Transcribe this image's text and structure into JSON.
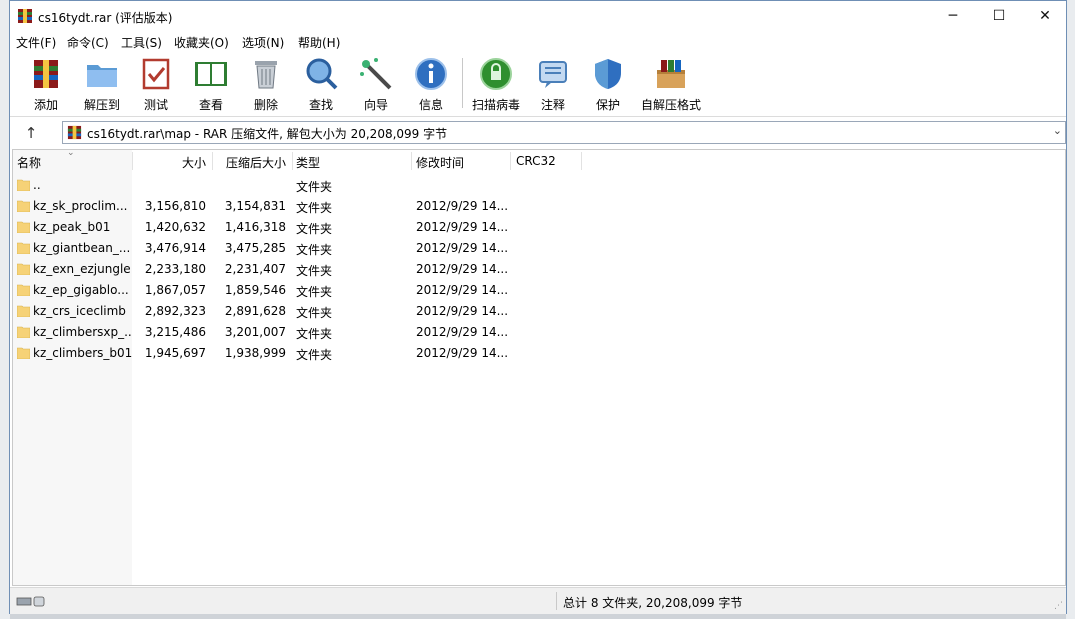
{
  "window": {
    "title": "cs16tydt.rar (评估版本)",
    "minimize": "─",
    "maximize": "☐",
    "close": "✕"
  },
  "menu": [
    "文件(F)",
    "命令(C)",
    "工具(S)",
    "收藏夹(O)",
    "选项(N)",
    "帮助(H)"
  ],
  "toolbar": [
    {
      "label": "添加",
      "icon": "add-archive-icon"
    },
    {
      "label": "解压到",
      "icon": "extract-folder-icon"
    },
    {
      "label": "测试",
      "icon": "test-checklist-icon"
    },
    {
      "label": "查看",
      "icon": "view-book-icon"
    },
    {
      "label": "删除",
      "icon": "trash-icon"
    },
    {
      "label": "查找",
      "icon": "magnifier-icon"
    },
    {
      "label": "向导",
      "icon": "wizard-wand-icon"
    },
    {
      "label": "信息",
      "icon": "info-icon"
    },
    {
      "label": "扫描病毒",
      "icon": "virus-scan-icon"
    },
    {
      "label": "注释",
      "icon": "comment-icon"
    },
    {
      "label": "保护",
      "icon": "shield-icon"
    },
    {
      "label": "自解压格式",
      "icon": "sfx-box-icon"
    }
  ],
  "address": {
    "up": "↑",
    "path": "cs16tydt.rar\\map - RAR 压缩文件, 解包大小为 20,208,099 字节",
    "dropdown": "⌄"
  },
  "columns": {
    "name": "名称",
    "size": "大小",
    "packed": "压缩后大小",
    "type": "类型",
    "modified": "修改时间",
    "crc": "CRC32",
    "sort_indicator": "⌄"
  },
  "rows": [
    {
      "name": "..",
      "size": "",
      "packed": "",
      "type": "文件夹",
      "modified": ""
    },
    {
      "name": "kz_sk_proclim...",
      "size": "3,156,810",
      "packed": "3,154,831",
      "type": "文件夹",
      "modified": "2012/9/29 14..."
    },
    {
      "name": "kz_peak_b01",
      "size": "1,420,632",
      "packed": "1,416,318",
      "type": "文件夹",
      "modified": "2012/9/29 14..."
    },
    {
      "name": "kz_giantbean_...",
      "size": "3,476,914",
      "packed": "3,475,285",
      "type": "文件夹",
      "modified": "2012/9/29 14..."
    },
    {
      "name": "kz_exn_ezjungle",
      "size": "2,233,180",
      "packed": "2,231,407",
      "type": "文件夹",
      "modified": "2012/9/29 14..."
    },
    {
      "name": "kz_ep_gigablo...",
      "size": "1,867,057",
      "packed": "1,859,546",
      "type": "文件夹",
      "modified": "2012/9/29 14..."
    },
    {
      "name": "kz_crs_iceclimb",
      "size": "2,892,323",
      "packed": "2,891,628",
      "type": "文件夹",
      "modified": "2012/9/29 14..."
    },
    {
      "name": "kz_climbersxp_...",
      "size": "3,215,486",
      "packed": "3,201,007",
      "type": "文件夹",
      "modified": "2012/9/29 14..."
    },
    {
      "name": "kz_climbers_b01",
      "size": "1,945,697",
      "packed": "1,938,999",
      "type": "文件夹",
      "modified": "2012/9/29 14..."
    }
  ],
  "status": {
    "summary": "总计 8 文件夹, 20,208,099 字节"
  },
  "colors": {
    "folder": "#f6d277",
    "winrar_red": "#c0392b",
    "accent_blue": "#2b6cc4"
  }
}
